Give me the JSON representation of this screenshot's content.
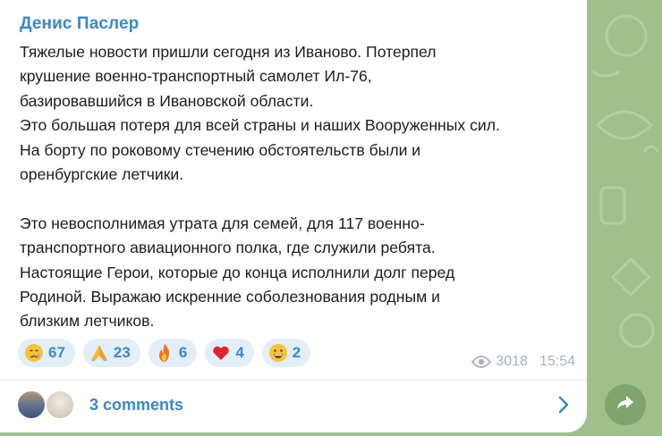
{
  "post": {
    "sender": "Денис Паслер",
    "text": "Тяжелые новости пришли сегодня из Иваново. Потерпел\nкрушение военно-транспортный самолет Ил-76,\nбазировавшийся в Ивановской области.\nЭто большая потеря для всей страны и наших Вооруженных сил.\nНа борту по роковому стечению обстоятельств были и\nоренбургские летчики.\n\nЭто невосполнимая утрата для семей, для 117 военно-\nтранспортного авиационного полка, где служили ребята.\nНастоящие Герои, которые до конца исполнили долг перед\nРодиной. Выражаю искренние соболезнования родным и\nблизким летчиков.",
    "views": "3018",
    "time": "15:54"
  },
  "reactions": [
    {
      "icon": "crying-face-icon",
      "count": "67"
    },
    {
      "icon": "folded-hands-icon",
      "count": "23"
    },
    {
      "icon": "fire-icon",
      "count": "6"
    },
    {
      "icon": "red-heart-icon",
      "count": "4"
    },
    {
      "icon": "grinning-face-icon",
      "count": "2"
    }
  ],
  "comments": {
    "label": "3 comments"
  },
  "colors": {
    "accent": "#3d87c9",
    "reaction_bg": "#e4eef8",
    "chat_bg": "#9fc08b"
  }
}
